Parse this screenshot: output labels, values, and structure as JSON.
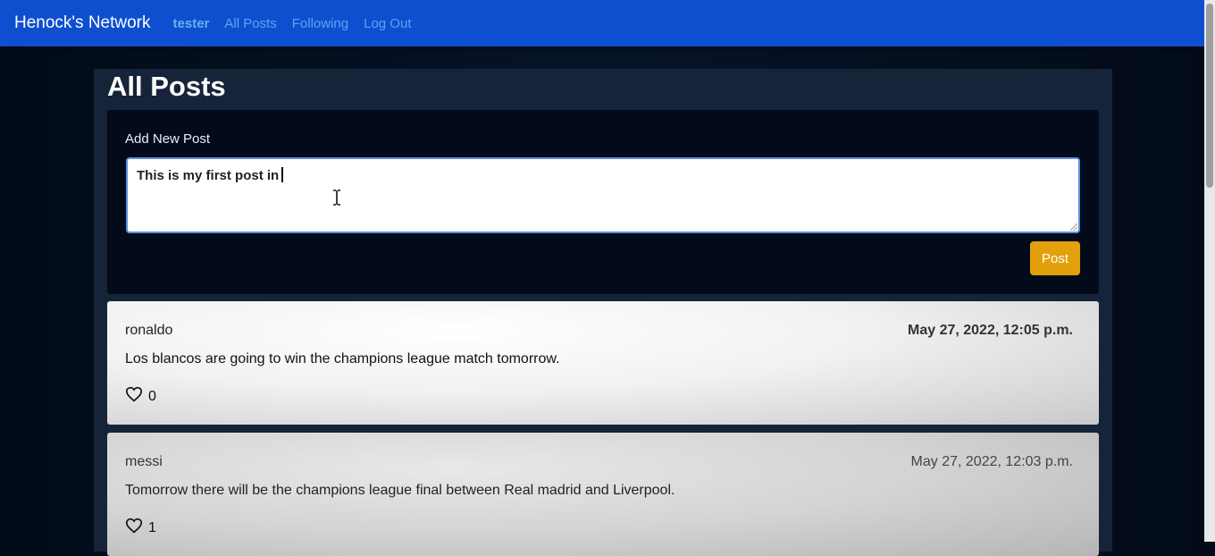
{
  "navbar": {
    "brand": "Henock's Network",
    "user": "tester",
    "links": [
      "All Posts",
      "Following",
      "Log Out"
    ],
    "color": "#0e4fd0"
  },
  "page": {
    "title": "All Posts"
  },
  "new_post": {
    "label": "Add New Post",
    "text": "This is my first post in",
    "button_label": "Post",
    "button_color": "#e2a00c"
  },
  "posts": [
    {
      "author": "ronaldo",
      "date": "May 27, 2022, 12:05 p.m.",
      "body": "Los blancos are going to win the champions league match tomorrow.",
      "likes": "0",
      "icon": "heart-icon"
    },
    {
      "author": "messi",
      "date": "May 27, 2022, 12:03 p.m.",
      "body": "Tomorrow there will be the champions league final between Real madrid and Liverpool.",
      "likes": "1",
      "icon": "heart-icon"
    }
  ]
}
